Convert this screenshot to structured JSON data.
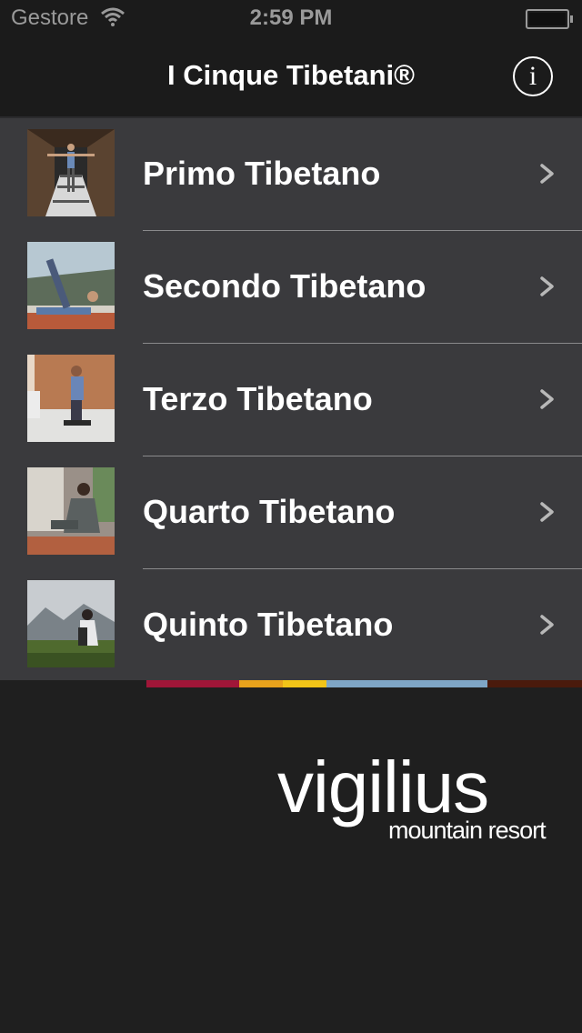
{
  "status_bar": {
    "carrier": "Gestore",
    "time": "2:59 PM"
  },
  "nav": {
    "title": "I Cinque Tibetani®",
    "info_label": "i"
  },
  "list": {
    "items": [
      {
        "label": "Primo Tibetano",
        "icon": "chevron-right-icon"
      },
      {
        "label": "Secondo Tibetano",
        "icon": "chevron-right-icon"
      },
      {
        "label": "Terzo Tibetano",
        "icon": "chevron-right-icon"
      },
      {
        "label": "Quarto Tibetano",
        "icon": "chevron-right-icon"
      },
      {
        "label": "Quinto Tibetano",
        "icon": "chevron-right-icon"
      }
    ]
  },
  "color_strip": [
    "#a01638",
    "#e8a21c",
    "#f2c418",
    "#7fa6c6",
    "#4a1a0c"
  ],
  "logo": {
    "main": "vigilius",
    "sub": "mountain resort"
  }
}
